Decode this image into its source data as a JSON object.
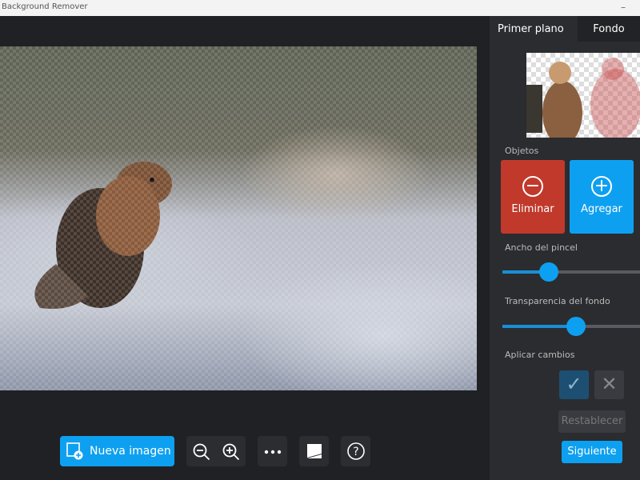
{
  "window": {
    "title": "Background Remover",
    "minimize": "–"
  },
  "tabs": [
    {
      "label": "Primer plano",
      "active": true
    },
    {
      "label": "Fondo",
      "active": false
    }
  ],
  "panel": {
    "objects_label": "Objetos",
    "remove_button": "Eliminar",
    "add_button": "Agregar",
    "brush_width_label": "Ancho del pincel",
    "brush_width_value": 0.3,
    "bg_transparency_label": "Transparencia del fondo",
    "bg_transparency_value": 0.5,
    "apply_label": "Aplicar cambios",
    "reset_button": "Restablecer",
    "next_button": "Siguiente"
  },
  "toolbar": {
    "new_image": "Nueva imagen"
  },
  "colors": {
    "accent": "#0ea0f0",
    "danger": "#c0392b"
  }
}
